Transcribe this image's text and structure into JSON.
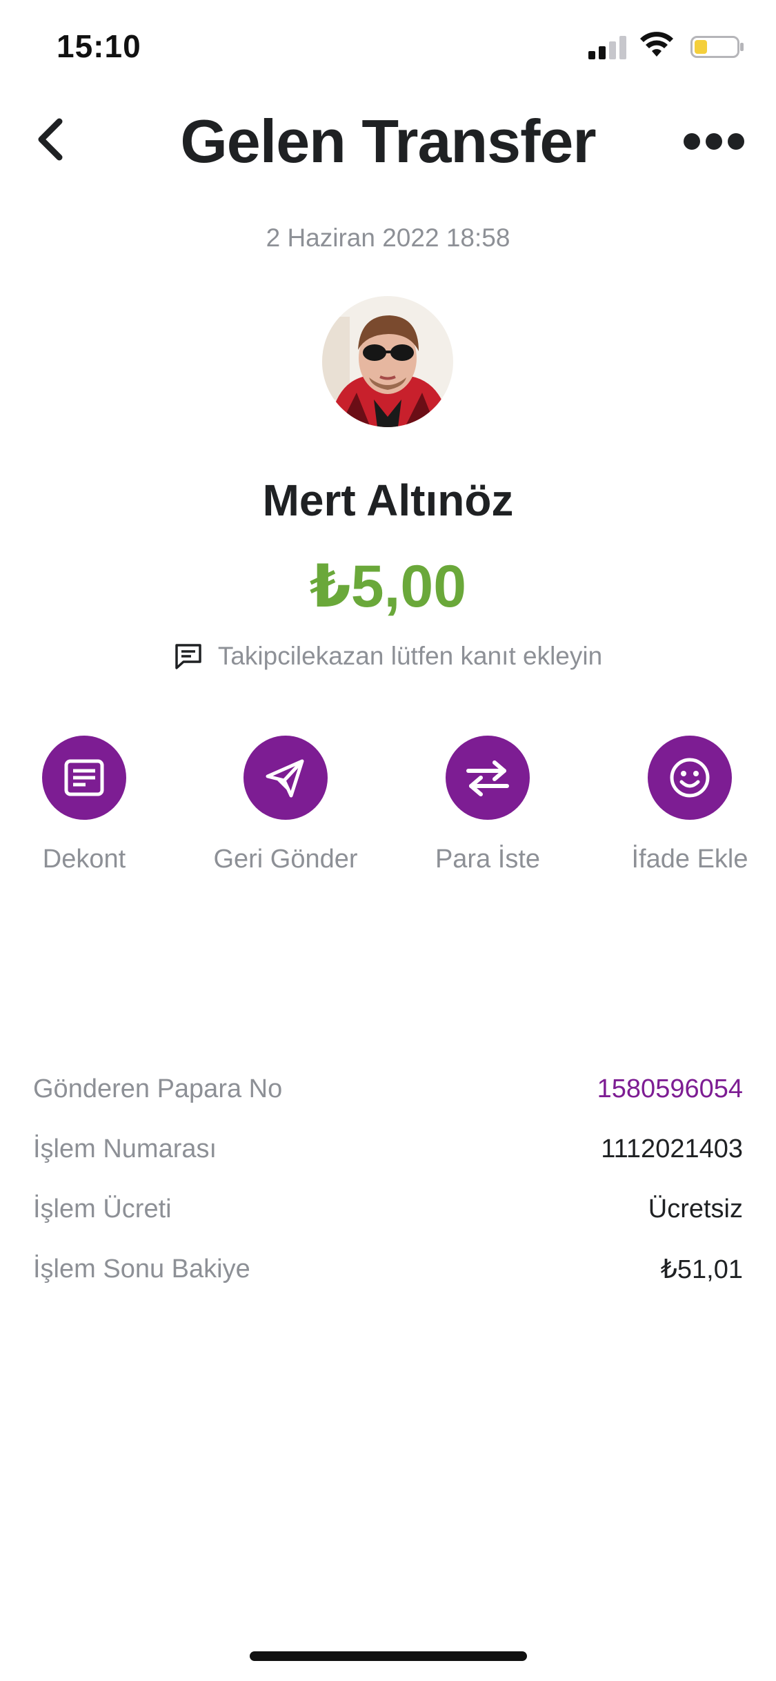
{
  "status_bar": {
    "time": "15:10"
  },
  "header": {
    "title": "Gelen Transfer"
  },
  "transfer": {
    "date": "2 Haziran 2022 18:58",
    "sender_name": "Mert Altınöz",
    "amount": "₺5,00",
    "note": "Takipcilekazan lütfen kanıt ekleyin"
  },
  "actions": [
    {
      "label": "Dekont",
      "icon": "receipt-icon"
    },
    {
      "label": "Geri Gönder",
      "icon": "send-icon"
    },
    {
      "label": "Para İste",
      "icon": "exchange-arrows-icon"
    },
    {
      "label": "İfade Ekle",
      "icon": "smiley-icon"
    }
  ],
  "details": [
    {
      "label": "Gönderen Papara No",
      "value": "1580596054"
    },
    {
      "label": "İşlem Numarası",
      "value": "1112021403"
    },
    {
      "label": "İşlem Ücreti",
      "value": "Ücretsiz"
    },
    {
      "label": "İşlem Sonu Bakiye",
      "value": "₺51,01"
    }
  ],
  "colors": {
    "accent_purple": "#7d1d93",
    "amount_green": "#6aa83a",
    "muted_text": "#8d9096",
    "primary_text": "#1f2123",
    "battery_fill": "#f4cf3c"
  }
}
